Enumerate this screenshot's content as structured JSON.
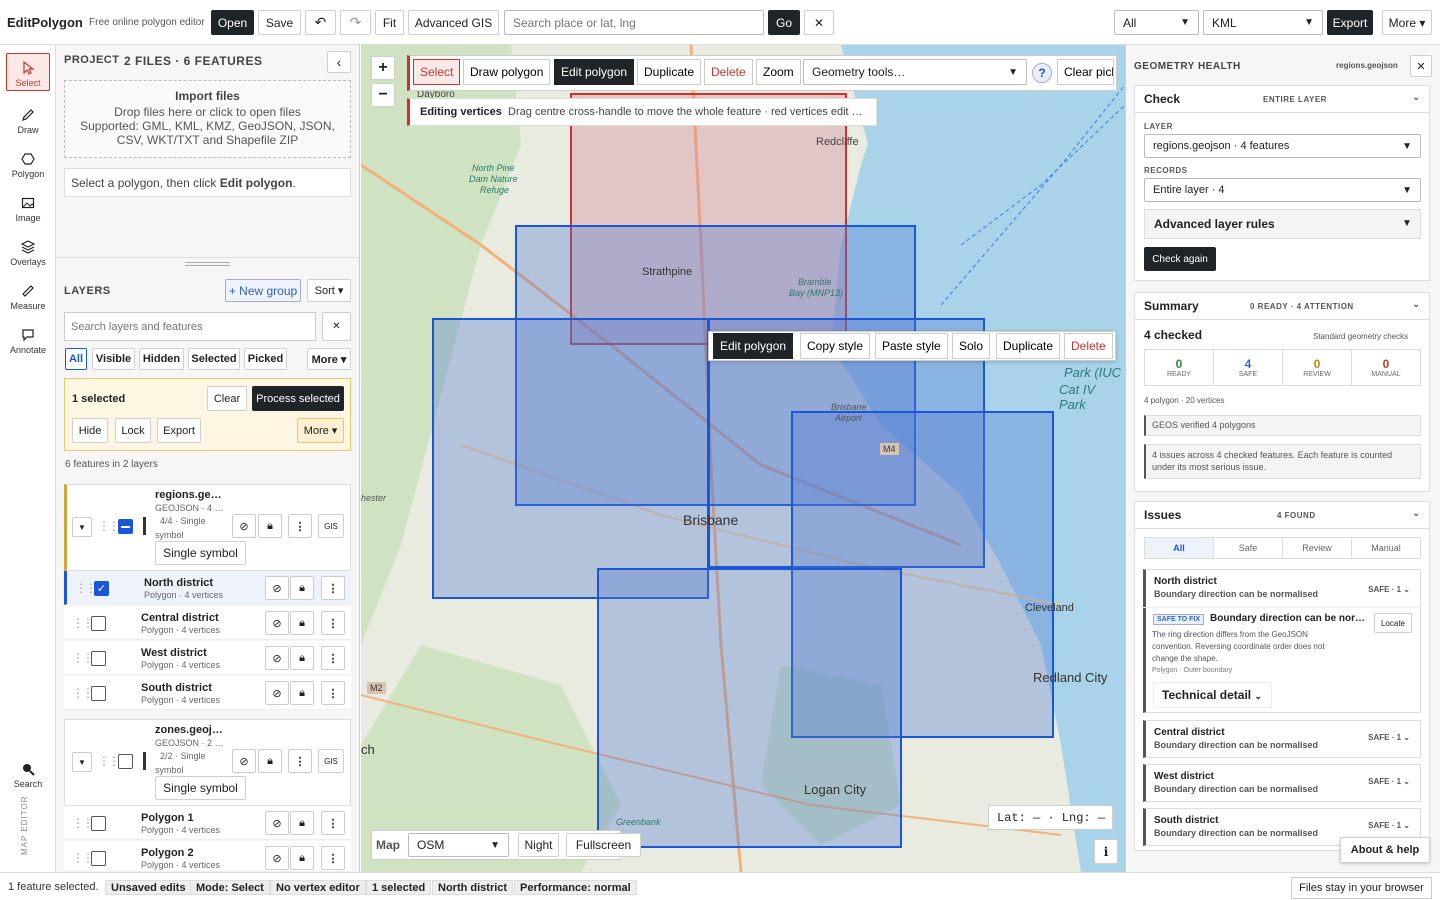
{
  "app": {
    "title": "EditPolygon",
    "tagline": "Free online polygon editor"
  },
  "toolbar": {
    "open": "Open",
    "save": "Save",
    "undo": "↶",
    "redo": "↷",
    "fit": "Fit",
    "advanced": "Advanced GIS",
    "search_placeholder": "Search place or lat, lng",
    "go": "Go",
    "clear": "✕",
    "filter": "All",
    "format": "KML",
    "export": "Export",
    "more": "More ▾"
  },
  "rail": [
    {
      "label": "Select",
      "icon": "cursor-icon"
    },
    {
      "label": "Draw",
      "icon": "pencil-icon"
    },
    {
      "label": "Polygon",
      "icon": "hexagon-icon"
    },
    {
      "label": "Image",
      "icon": "image-icon"
    },
    {
      "label": "Overlays",
      "icon": "layers-icon"
    },
    {
      "label": "Measure",
      "icon": "ruler-icon"
    },
    {
      "label": "Annotate",
      "icon": "comment-icon"
    },
    {
      "label": "Search",
      "icon": "search-icon"
    }
  ],
  "rail_footer": "MAP EDITOR",
  "project": {
    "label": "PROJECT",
    "summary": "2 FILES · 6 FEATURES",
    "collapse": "‹",
    "import_title": "Import files",
    "import_line1": "Drop files here or click to open files",
    "import_line2": "Supported: GML, KML, KMZ, GeoJSON, JSON,",
    "import_line3": "CSV, WKT/TXT and Shapefile ZIP",
    "hint_prefix": "Select a polygon, then click ",
    "hint_bold": "Edit polygon",
    "hint_suffix": "."
  },
  "layers": {
    "label": "LAYERS",
    "new_group": "+ New group",
    "sort": "Sort ▾",
    "search_placeholder": "Search layers and features",
    "search_clear": "✕",
    "filters": [
      "All",
      "Visible",
      "Hidden",
      "Selected",
      "Picked",
      "More ▾"
    ],
    "selection": {
      "count": "1 selected",
      "clear": "Clear",
      "process": "Process selected",
      "hide": "Hide",
      "lock": "Lock",
      "export": "Export",
      "more": "More ▾"
    },
    "summary": "6 features in 2 layers",
    "groups": [
      {
        "name": "regions.ge…",
        "meta": "GEOJSON · 4 …",
        "meta2": "4/4 · Single",
        "meta3": "symbol",
        "symbol": "Single symbol",
        "gis": "GIS",
        "items": [
          {
            "name": "North district",
            "sub": "Polygon · 4 vertices",
            "checked": true
          },
          {
            "name": "Central district",
            "sub": "Polygon · 4 vertices",
            "checked": false
          },
          {
            "name": "West district",
            "sub": "Polygon · 4 vertices",
            "checked": false
          },
          {
            "name": "South district",
            "sub": "Polygon · 4 vertices",
            "checked": false
          }
        ]
      },
      {
        "name": "zones.geoj…",
        "meta": "GEOJSON · 2 …",
        "meta2": "2/2 · Single",
        "meta3": "symbol",
        "symbol": "Single symbol",
        "gis": "GIS",
        "items": [
          {
            "name": "Polygon 1",
            "sub": "Polygon · 4 vertices",
            "checked": false
          },
          {
            "name": "Polygon 2",
            "sub": "Polygon · 4 vertices",
            "checked": false
          }
        ]
      }
    ]
  },
  "map": {
    "zoom_in": "+",
    "zoom_out": "−",
    "tools": {
      "select": "Select",
      "draw": "Draw polygon",
      "edit": "Edit polygon",
      "duplicate": "Duplicate",
      "delete": "Delete",
      "zoom": "Zoom",
      "geometry": "Geometry tools…",
      "help": "?",
      "clear_pick": "Clear pick"
    },
    "edit_banner_bold": "Editing vertices",
    "edit_banner_text": "Drag centre cross-handle to move the whole feature · red vertices edit …",
    "context": {
      "edit": "Edit polygon",
      "copy": "Copy style",
      "paste": "Paste style",
      "solo": "Solo",
      "duplicate": "Duplicate",
      "delete": "Delete"
    },
    "labels": {
      "dayboro": "Dayboro",
      "redcliffe": "Redcliffe",
      "strathpine": "Strathpine",
      "brisbane": "Brisbane",
      "cleveland": "Cleveland",
      "redland": "Redland City",
      "logan": "Logan City",
      "park": "Park (IUC",
      "park2": "Cat IV Park",
      "northpine": "North Pine",
      "northpine2": "Dam Nature",
      "northpine3": "Refuge",
      "bramble": "Bramble",
      "bramble2": "Bay (MNP13)",
      "airport": "Brisbane",
      "airport2": "Airport",
      "greenbank": "Greenbank",
      "chester": "hester",
      "ch": "ch",
      "m4": "M4",
      "m2": "M2"
    },
    "bottom": {
      "map_label": "Map",
      "layer": "OSM",
      "night": "Night",
      "fullscreen": "Fullscreen",
      "coords": "Lat: — · Lng: —",
      "info": "i"
    }
  },
  "health": {
    "title": "GEOMETRY HEALTH",
    "file": "regions.geojson",
    "close": "✕",
    "check": {
      "title": "Check",
      "scope": "ENTIRE LAYER",
      "layer_label": "LAYER",
      "layer_value": "regions.geojson · 4 features",
      "records_label": "RECORDS",
      "records_value": "Entire layer · 4",
      "advanced": "Advanced layer rules",
      "run": "Check again"
    },
    "summary": {
      "title": "Summary",
      "status": "0 READY · 4 ATTENTION",
      "checked": "4 checked",
      "standard": "Standard geometry checks",
      "stats": [
        {
          "value": "0",
          "label": "READY",
          "color": "#2e8b3a"
        },
        {
          "value": "4",
          "label": "SAFE",
          "color": "#2f6db5"
        },
        {
          "value": "0",
          "label": "REVIEW",
          "color": "#b8860b"
        },
        {
          "value": "0",
          "label": "MANUAL",
          "color": "#c0392b"
        }
      ],
      "info": "4 polygon · 20 vertices",
      "geos": "GEOS verified 4 polygons",
      "note": "4 issues across 4 checked features. Each feature is counted under its most serious issue."
    },
    "issues": {
      "title": "Issues",
      "count": "4 FOUND",
      "tabs": [
        "All",
        "Safe",
        "Review",
        "Manual"
      ],
      "list": [
        {
          "name": "North district",
          "desc": "Boundary direction can be normalised",
          "rank": "SAFE · 1"
        },
        {
          "name": "Central district",
          "desc": "Boundary direction can be normalised",
          "rank": "SAFE · 1"
        },
        {
          "name": "West district",
          "desc": "Boundary direction can be normalised",
          "rank": "SAFE · 1"
        },
        {
          "name": "South district",
          "desc": "Boundary direction can be normalised",
          "rank": "SAFE · 1"
        }
      ],
      "detail": {
        "badge": "SAFE TO FIX",
        "title": "Boundary direction can be nor…",
        "locate": "Locate",
        "body1": "The ring direction differs from the GeoJSON",
        "body2": "convention. Reversing coordinate order does not",
        "body3": "change the shape.",
        "meta": "Polygon · Outer boundary",
        "technical": "Technical detail"
      }
    },
    "about": "About & help"
  },
  "status": {
    "selected": "1 feature selected.",
    "chips": [
      "Unsaved edits",
      "Mode: Select",
      "No vertex editor",
      "1 selected",
      "North district",
      "Performance: normal"
    ],
    "right": "Files stay in your browser"
  },
  "colors": {
    "accent": "#1f2428",
    "selection_blue": "#1a57d6",
    "red_outline": "#d0312d",
    "map_water": "#a8d3e8",
    "map_land": "#e8eadf"
  }
}
